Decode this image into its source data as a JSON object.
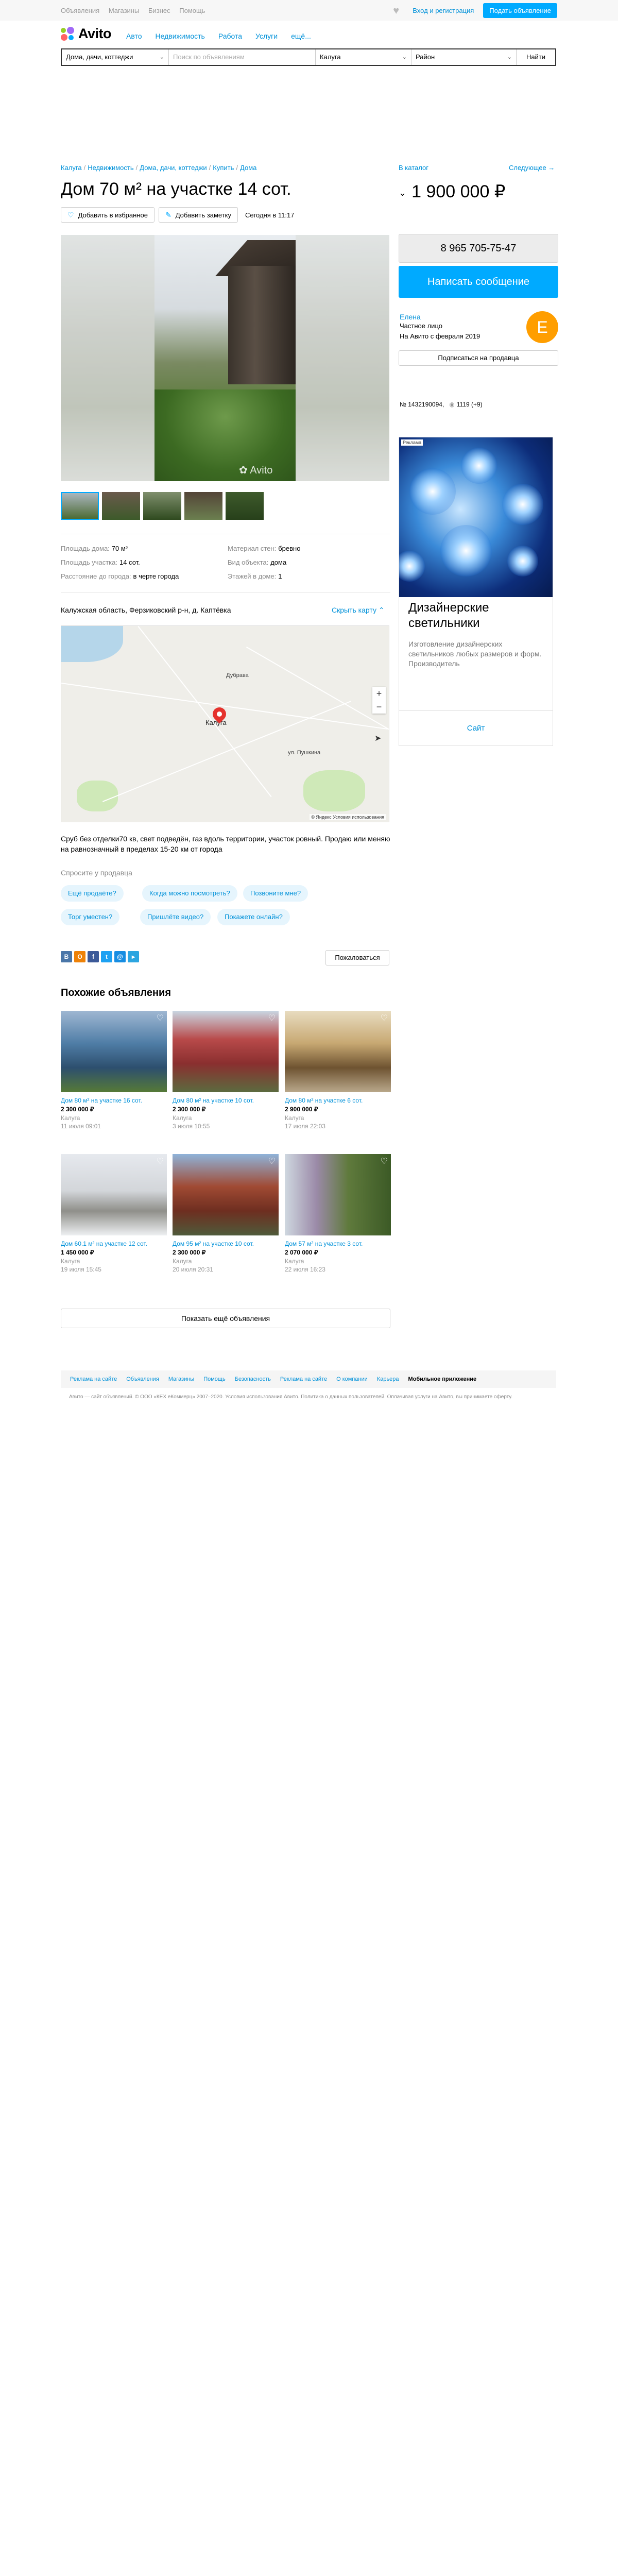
{
  "topbar": {
    "nav": [
      "Объявления",
      "Магазины",
      "Бизнес",
      "Помощь"
    ],
    "login": "Вход и регистрация",
    "post_ad": "Подать объявление"
  },
  "header": {
    "logo": "Avito",
    "categories": [
      "Авто",
      "Недвижимость",
      "Работа",
      "Услуги",
      "ещё..."
    ]
  },
  "search": {
    "category": "Дома, дачи, коттеджи",
    "placeholder": "Поиск по объявлениям",
    "city": "Калуга",
    "district": "Район",
    "find": "Найти"
  },
  "breadcrumbs": [
    "Калуга",
    "Недвижимость",
    "Дома, дачи, коттеджи",
    "Купить",
    "Дома"
  ],
  "nav_links": {
    "catalog": "В каталог",
    "next": "Следующее →"
  },
  "listing": {
    "title": "Дом 70 м² на участке 14 сот.",
    "price": "1 900 000 ₽",
    "add_favorite": "Добавить в избранное",
    "add_note": "Добавить заметку",
    "posted": "Сегодня в 11:17",
    "watermark": "Avito"
  },
  "contact": {
    "phone": "8 965 705-75-47",
    "message": "Написать сообщение",
    "seller_name": "Елена",
    "seller_type": "Частное лицо",
    "seller_since": "На Авито с февраля 2019",
    "avatar_letter": "E",
    "subscribe": "Подписаться на продавца",
    "ad_number": "№ 1432190094,",
    "views": "1119 (+9)"
  },
  "banner": {
    "tag": "Реклама",
    "title": "Дизайнерские светильники",
    "text": "Изготовление дизайнерских светильников любых размеров и форм. Производитель",
    "button": "Сайт"
  },
  "params": [
    {
      "k": "Площадь дома:",
      "v": "70 м²"
    },
    {
      "k": "Материал стен:",
      "v": "бревно"
    },
    {
      "k": "Площадь участка:",
      "v": "14 сот."
    },
    {
      "k": "Вид объекта:",
      "v": "дома"
    },
    {
      "k": "Расстояние до города:",
      "v": "в черте города"
    },
    {
      "k": "Этажей в доме:",
      "v": "1"
    }
  ],
  "location": {
    "address": "Калужская область, Ферзиковский р-н, д. Каптёвка",
    "hide_map": "Скрыть карту",
    "map_labels": [
      "Калуга",
      "Дубрава",
      "ул. Пушкина"
    ],
    "map_footer": "© Яндекс Условия использования"
  },
  "description": "Сруб без отделки70 кв, свет подведён, газ вдоль территории, участок ровный. Продаю или меняю на равнозначный в пределах 15-20 км от города",
  "ask": {
    "title": "Спросите у продавца",
    "chips": [
      "Ещё продаёте?",
      "Когда можно посмотреть?",
      "Позвоните мне?",
      "Торг уместен?",
      "Пришлёте видео?",
      "Покажете онлайн?"
    ]
  },
  "share": {
    "icons": [
      "В",
      "О",
      "f",
      "t",
      "@",
      "▸"
    ],
    "complain": "Пожаловаться"
  },
  "similar": {
    "title": "Похожие объявления",
    "items": [
      {
        "title": "Дом 80 м² на участке 16 сот.",
        "price": "2 300 000 ₽",
        "city": "Калуга",
        "date": "11 июля 09:01"
      },
      {
        "title": "Дом 80 м² на участке 10 сот.",
        "price": "2 300 000 ₽",
        "city": "Калуга",
        "date": "3 июля 10:55"
      },
      {
        "title": "Дом 80 м² на участке 6 сот.",
        "price": "2 900 000 ₽",
        "city": "Калуга",
        "date": "17 июля 22:03"
      },
      {
        "title": "Дом 60.1 м² на участке 12 сот.",
        "price": "1 450 000 ₽",
        "city": "Калуга",
        "date": "19 июля 15:45"
      },
      {
        "title": "Дом 95 м² на участке 10 сот.",
        "price": "2 300 000 ₽",
        "city": "Калуга",
        "date": "20 июля 20:31"
      },
      {
        "title": "Дом 57 м² на участке 3 сот.",
        "price": "2 070 000 ₽",
        "city": "Калуга",
        "date": "22 июля 16:23"
      }
    ],
    "show_all": "Показать ещё объявления"
  },
  "footer": {
    "links": [
      "Реклама на сайте",
      "Объявления",
      "Магазины",
      "Помощь",
      "Безопасность",
      "Реклама на сайте",
      "О компании",
      "Карьера",
      "Мобильное приложение"
    ],
    "copy": "Авито — сайт объявлений. © ООО «КЕХ еКоммерц» 2007–2020. Условия использования Авито. Политика о данных пользователей. Оплачивая услуги на Авито, вы принимаете оферту."
  },
  "colors": {
    "accent": "#00aaff",
    "link": "#0091d9",
    "avatar": "#ff9e00",
    "pin": "#e5322d"
  }
}
